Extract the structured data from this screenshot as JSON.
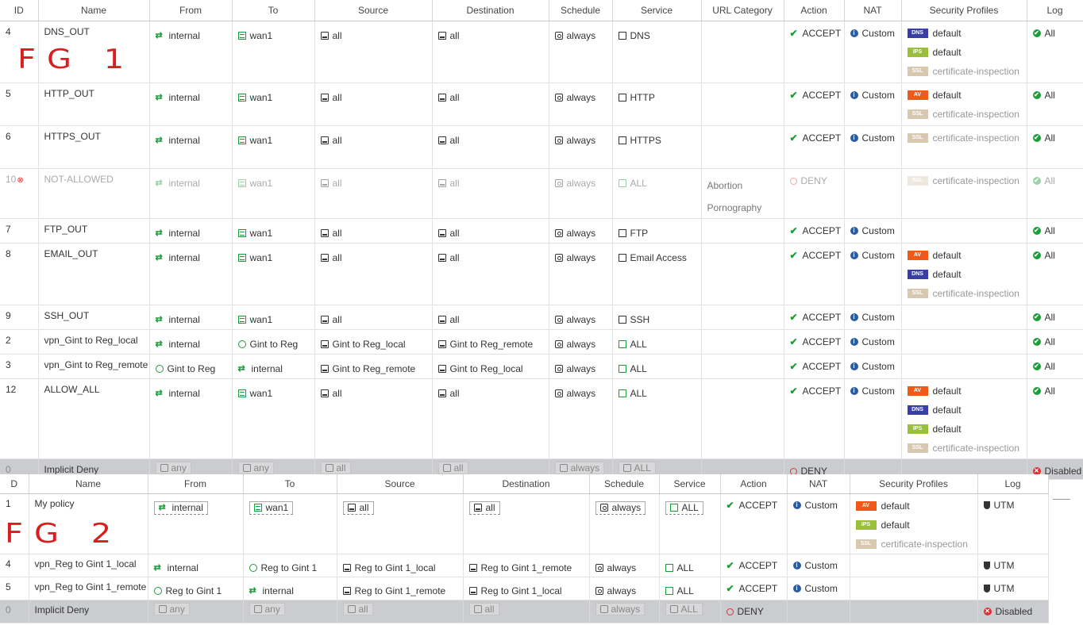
{
  "table1": {
    "headers": [
      "ID",
      "Name",
      "From",
      "To",
      "Source",
      "Destination",
      "Schedule",
      "Service",
      "URL Category",
      "Action",
      "NAT",
      "Security Profiles",
      "Log"
    ],
    "annotation": "FG 1",
    "rows": [
      {
        "id": "4",
        "name": "DNS_OUT",
        "from": "internal",
        "to": "wan1",
        "source": "all",
        "dest": "all",
        "schedule": "always",
        "service": "DNS",
        "url": "",
        "action": "ACCEPT",
        "nat": "Custom",
        "profiles": [
          {
            "badge": "DNS",
            "label": "default"
          },
          {
            "badge": "IPS",
            "label": "default"
          },
          {
            "badge": "SSL",
            "label": "certificate-inspection"
          }
        ],
        "log": "All"
      },
      {
        "id": "5",
        "name": "HTTP_OUT",
        "from": "internal",
        "to": "wan1",
        "source": "all",
        "dest": "all",
        "schedule": "always",
        "service": "HTTP",
        "url": "",
        "action": "ACCEPT",
        "nat": "Custom",
        "profiles": [
          {
            "badge": "AV",
            "label": "default"
          },
          {
            "badge": "SSL",
            "label": "certificate-inspection"
          }
        ],
        "log": "All"
      },
      {
        "id": "6",
        "name": "HTTPS_OUT",
        "from": "internal",
        "to": "wan1",
        "source": "all",
        "dest": "all",
        "schedule": "always",
        "service": "HTTPS",
        "url": "",
        "action": "ACCEPT",
        "nat": "Custom",
        "profiles": [
          {
            "badge": "SSL",
            "label": "certificate-inspection"
          }
        ],
        "log": "All"
      },
      {
        "id": "10",
        "name": "NOT-ALLOWED",
        "from": "internal",
        "to": "wan1",
        "source": "all",
        "dest": "all",
        "schedule": "always",
        "service": "ALL",
        "url": [
          "Abortion",
          "Pornography"
        ],
        "action": "DENY",
        "nat": "",
        "profiles": [
          {
            "badge": "SSL",
            "label": "certificate-inspection"
          }
        ],
        "log": "All",
        "disabled": true
      },
      {
        "id": "7",
        "name": "FTP_OUT",
        "from": "internal",
        "to": "wan1",
        "source": "all",
        "dest": "all",
        "schedule": "always",
        "service": "FTP",
        "url": "",
        "action": "ACCEPT",
        "nat": "Custom",
        "profiles": [],
        "log": "All"
      },
      {
        "id": "8",
        "name": "EMAIL_OUT",
        "from": "internal",
        "to": "wan1",
        "source": "all",
        "dest": "all",
        "schedule": "always",
        "service": "Email Access",
        "url": "",
        "action": "ACCEPT",
        "nat": "Custom",
        "profiles": [
          {
            "badge": "AV",
            "label": "default"
          },
          {
            "badge": "DNS",
            "label": "default"
          },
          {
            "badge": "SSL",
            "label": "certificate-inspection"
          }
        ],
        "log": "All"
      },
      {
        "id": "9",
        "name": "SSH_OUT",
        "from": "internal",
        "to": "wan1",
        "source": "all",
        "dest": "all",
        "schedule": "always",
        "service": "SSH",
        "url": "",
        "action": "ACCEPT",
        "nat": "Custom",
        "profiles": [],
        "log": "All"
      },
      {
        "id": "2",
        "name": "vpn_Gint to Reg_local",
        "from": "internal",
        "to": "Gint to Reg",
        "source": "Gint to Reg_local",
        "dest": "Gint to Reg_remote",
        "schedule": "always",
        "service": "ALL",
        "url": "",
        "action": "ACCEPT",
        "nat": "Custom",
        "profiles": [],
        "log": "All"
      },
      {
        "id": "3",
        "name": "vpn_Gint to Reg_remote",
        "from": "Gint to Reg",
        "to": "internal",
        "source": "Gint to Reg_remote",
        "dest": "Gint to Reg_local",
        "schedule": "always",
        "service": "ALL",
        "url": "",
        "action": "ACCEPT",
        "nat": "Custom",
        "profiles": [],
        "log": "All"
      },
      {
        "id": "12",
        "name": "ALLOW_ALL",
        "from": "internal",
        "to": "wan1",
        "source": "all",
        "dest": "all",
        "schedule": "always",
        "service": "ALL",
        "url": "",
        "action": "ACCEPT",
        "nat": "Custom",
        "profiles": [
          {
            "badge": "AV",
            "label": "default"
          },
          {
            "badge": "DNS",
            "label": "default"
          },
          {
            "badge": "IPS",
            "label": "default"
          },
          {
            "badge": "SSL",
            "label": "certificate-inspection"
          }
        ],
        "log": "All"
      }
    ],
    "implicit": {
      "id": "0",
      "name": "Implicit Deny",
      "from": "any",
      "to": "any",
      "source": "all",
      "dest": "all",
      "schedule": "always",
      "service": "ALL",
      "action": "DENY",
      "log": "Disabled"
    }
  },
  "table2": {
    "headers": [
      "D",
      "Name",
      "From",
      "To",
      "Source",
      "Destination",
      "Schedule",
      "Service",
      "Action",
      "NAT",
      "Security Profiles",
      "Log"
    ],
    "annotation": "FG 2",
    "rows": [
      {
        "id": "1",
        "name": "My policy",
        "from": "internal",
        "to": "wan1",
        "source": "all",
        "dest": "all",
        "schedule": "always",
        "service": "ALL",
        "action": "ACCEPT",
        "nat": "Custom",
        "profiles": [
          {
            "badge": "AV",
            "label": "default"
          },
          {
            "badge": "IPS",
            "label": "default"
          },
          {
            "badge": "SSL",
            "label": "certificate-inspection"
          }
        ],
        "log": "UTM"
      },
      {
        "id": "4",
        "name": "vpn_Reg to Gint 1_local",
        "from": "internal",
        "to": "Reg to Gint 1",
        "source": "Reg to Gint 1_local",
        "dest": "Reg to Gint 1_remote",
        "schedule": "always",
        "service": "ALL",
        "action": "ACCEPT",
        "nat": "Custom",
        "profiles": [],
        "log": "UTM"
      },
      {
        "id": "5",
        "name": "vpn_Reg to Gint 1_remote",
        "from": "Reg to Gint 1",
        "to": "internal",
        "source": "Reg to Gint 1_remote",
        "dest": "Reg to Gint 1_local",
        "schedule": "always",
        "service": "ALL",
        "action": "ACCEPT",
        "nat": "Custom",
        "profiles": [],
        "log": "UTM"
      }
    ],
    "implicit": {
      "id": "0",
      "name": "Implicit Deny",
      "from": "any",
      "to": "any",
      "source": "all",
      "dest": "all",
      "schedule": "always",
      "service": "ALL",
      "action": "DENY",
      "log": "Disabled"
    }
  }
}
